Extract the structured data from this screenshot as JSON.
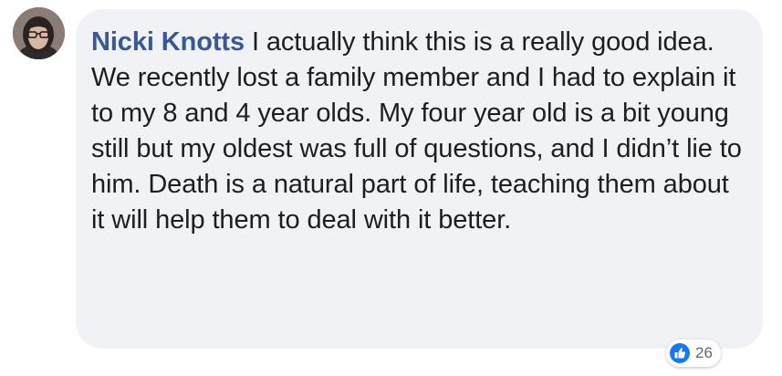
{
  "comment": {
    "author": "Nicki Knotts",
    "text": "I actually think this is a really good idea. We recently lost a family member and I had to explain it to my 8 and 4 year olds. My four year old is a bit young still but my oldest was full of questions, and I didn’t lie to him. Death is a natural part of life, teaching them about it will help them to deal with it better."
  },
  "reactions": {
    "icon": "like-icon",
    "count": "26"
  },
  "colors": {
    "author": "#385898",
    "bubble": "#f1f2f6",
    "text": "#1c1e21",
    "like": "#1877f2"
  }
}
